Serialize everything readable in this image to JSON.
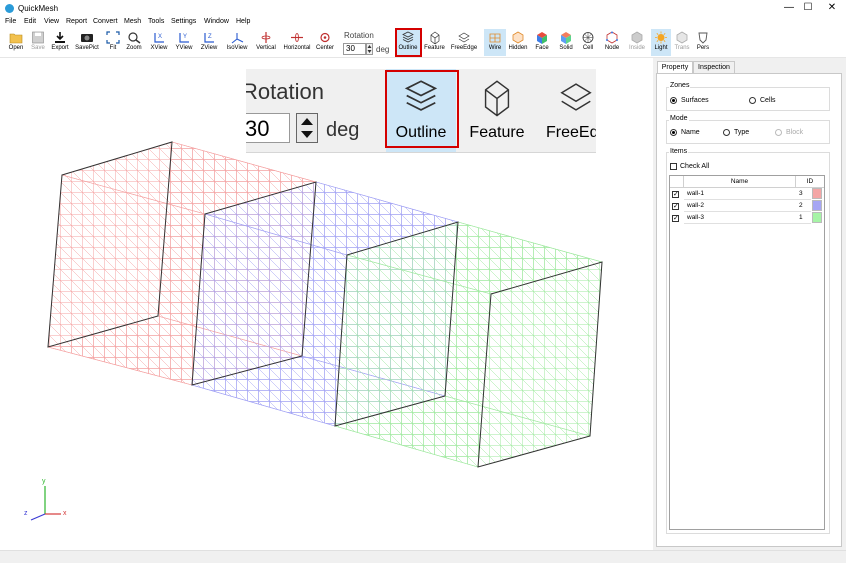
{
  "window": {
    "title": "QuickMesh",
    "controls": [
      "—",
      "☐",
      "✕"
    ]
  },
  "menu": [
    "File",
    "Edit",
    "View",
    "Report",
    "Convert",
    "Mesh",
    "Tools",
    "Settings",
    "Window",
    "Help"
  ],
  "toolbar": {
    "buttons": [
      {
        "label": "Open",
        "icon": "folder-icon"
      },
      {
        "label": "Save",
        "icon": "save-icon",
        "disabled": true
      },
      {
        "label": "Export",
        "icon": "export-icon"
      },
      {
        "label": "SavePict",
        "icon": "camera-icon"
      },
      {
        "label": "Fit",
        "icon": "fit-icon"
      },
      {
        "label": "Zoom",
        "icon": "zoom-icon"
      },
      {
        "label": "XView",
        "icon": "xview-icon"
      },
      {
        "label": "YView",
        "icon": "yview-icon"
      },
      {
        "label": "ZView",
        "icon": "zview-icon"
      },
      {
        "label": "IsoView",
        "icon": "isoview-icon"
      },
      {
        "label": "Vertical",
        "icon": "vertical-icon"
      },
      {
        "label": "Horizontal",
        "icon": "horizontal-icon"
      },
      {
        "label": "Center",
        "icon": "center-icon"
      }
    ],
    "rotation": {
      "label": "Rotation",
      "value": "30",
      "unit": "deg"
    },
    "view_buttons": [
      {
        "label": "Outline",
        "icon": "outline-icon",
        "active": true
      },
      {
        "label": "Feature",
        "icon": "feature-icon"
      },
      {
        "label": "FreeEdge",
        "icon": "freeedge-icon"
      },
      {
        "label": "Wire",
        "icon": "wire-icon",
        "active": true
      },
      {
        "label": "Hidden",
        "icon": "hidden-icon"
      },
      {
        "label": "Face",
        "icon": "face-icon"
      },
      {
        "label": "Solid",
        "icon": "solid-icon"
      },
      {
        "label": "Cell",
        "icon": "cell-icon"
      },
      {
        "label": "Node",
        "icon": "node-icon"
      },
      {
        "label": "Inside",
        "icon": "inside-icon",
        "disabled": true
      },
      {
        "label": "Light",
        "icon": "light-icon",
        "active": true
      },
      {
        "label": "Trans",
        "icon": "trans-icon",
        "disabled": true
      },
      {
        "label": "Pers",
        "icon": "pers-icon"
      }
    ]
  },
  "zoom_inset": {
    "rotation_label": "Rotation",
    "value": "30",
    "unit": "deg",
    "buttons": [
      "Outline",
      "Feature",
      "FreeEd"
    ]
  },
  "axes": {
    "x": "x",
    "y": "y",
    "z": "z"
  },
  "colors": {
    "wall1": "#f08080",
    "wall2": "#8080f0",
    "wall3": "#80f080",
    "active": "#cde6f7",
    "highlight": "#d40000"
  },
  "panel": {
    "tabs": [
      "Property",
      "Inspection"
    ],
    "zones": {
      "title": "Zones",
      "options": [
        "Surfaces",
        "Cells"
      ],
      "selected": "Surfaces"
    },
    "mode": {
      "title": "Mode",
      "options": [
        "Name",
        "Type",
        "Block"
      ],
      "selected": "Name"
    },
    "items": {
      "title": "Items",
      "check_all": "Check All",
      "columns": [
        "Name",
        "ID"
      ],
      "rows": [
        {
          "name": "wall-1",
          "id": "3",
          "checked": true,
          "color": "#f4a6a6"
        },
        {
          "name": "wall-2",
          "id": "2",
          "checked": true,
          "color": "#a6a6f4"
        },
        {
          "name": "wall-3",
          "id": "1",
          "checked": true,
          "color": "#a6f4a6"
        }
      ]
    }
  }
}
